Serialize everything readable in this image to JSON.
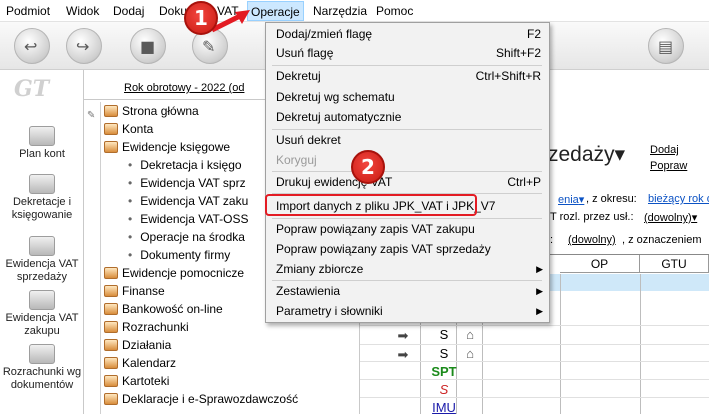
{
  "menubar": {
    "items": [
      "Podmiot",
      "Widok",
      "Dodaj",
      "Dokument VAT",
      "Operacje",
      "Narzędzia",
      "Pomoc"
    ]
  },
  "toolbar": {
    "icons": [
      "back-icon",
      "forward-icon",
      "stamp-icon",
      "pen-icon",
      "document-icon"
    ]
  },
  "sidebar": {
    "logo": "GT",
    "items": [
      {
        "label": "Plan kont"
      },
      {
        "label": "Dekretacje i księgowanie"
      },
      {
        "label": "Ewidencja VAT sprzedaży"
      },
      {
        "label": "Ewidencja VAT zakupu"
      },
      {
        "label": "Rozrachunki wg dokumentów"
      }
    ]
  },
  "year_label": "Rok obrotowy - 2022  (od",
  "tree": {
    "items": [
      {
        "label": "Strona główna",
        "level": 0
      },
      {
        "label": "Konta",
        "level": 0
      },
      {
        "label": "Ewidencje księgowe",
        "level": 0
      },
      {
        "label": "Dekretacja i księgo",
        "level": 1
      },
      {
        "label": "Ewidencja VAT sprz",
        "level": 1
      },
      {
        "label": "Ewidencja VAT zaku",
        "level": 1
      },
      {
        "label": "Ewidencja VAT-OSS",
        "level": 1
      },
      {
        "label": "Operacje na środka",
        "level": 1
      },
      {
        "label": "Dokumenty firmy",
        "level": 1
      },
      {
        "label": "Ewidencje pomocnicze",
        "level": 0
      },
      {
        "label": "Finanse",
        "level": 0
      },
      {
        "label": "Bankowość on-line",
        "level": 0
      },
      {
        "label": "Rozrachunki",
        "level": 0
      },
      {
        "label": "Działania",
        "level": 0
      },
      {
        "label": "Kalendarz",
        "level": 0
      },
      {
        "label": "Kartoteki",
        "level": 0
      },
      {
        "label": "Deklaracje i e-Sprawozdawczość",
        "level": 0
      }
    ]
  },
  "main": {
    "title": "zedaży",
    "add_link": "Dodaj",
    "correct_link": "Popraw",
    "filter1_value": "enia",
    "filter1_period_label": ", z okresu:",
    "filter1_period_value": "bieżący rok o",
    "filter2_label": "T rozl. przez usł.:",
    "filter2_value": "(dowolny)",
    "filter3_label": ":",
    "filter3_value": "(dowolny)",
    "filter3_suffix": ", z oznaczeniem"
  },
  "grid": {
    "headers": [
      "OP",
      "GTU"
    ],
    "rows": [
      {
        "arrow": "➡",
        "code": "S",
        "icon": "house-icon"
      },
      {
        "arrow": "➡",
        "code": "S",
        "icon": "house-icon"
      },
      {
        "arrow": "",
        "code": "SPT",
        "icon": ""
      },
      {
        "arrow": "",
        "code": "S",
        "icon": ""
      },
      {
        "arrow": "",
        "code": "IMU",
        "icon": ""
      }
    ],
    "colors": {
      "spt": "#1a8a1a",
      "s_red": "#cc2222",
      "imu": "#1a1aaa"
    }
  },
  "dropdown": {
    "items": [
      {
        "label": "Dodaj/zmień flagę",
        "shortcut": "F2",
        "enabled": true
      },
      {
        "label": "Usuń flagę",
        "shortcut": "Shift+F2",
        "enabled": true
      },
      {
        "label": "Dekretuj",
        "shortcut": "Ctrl+Shift+R",
        "enabled": true
      },
      {
        "label": "Dekretuj wg schematu",
        "shortcut": "",
        "enabled": true
      },
      {
        "label": "Dekretuj automatycznie",
        "shortcut": "",
        "enabled": true
      },
      {
        "label": "Usuń dekret",
        "shortcut": "",
        "enabled": true
      },
      {
        "label": "Koryguj",
        "shortcut": "",
        "enabled": false
      },
      {
        "label": "Drukuj ewidencję VAT",
        "shortcut": "Ctrl+P",
        "enabled": true
      },
      {
        "label": "Import danych z pliku JPK_VAT i JPK_V7",
        "shortcut": "",
        "enabled": true
      },
      {
        "label": "Popraw powiązany zapis VAT zakupu",
        "shortcut": "",
        "enabled": true
      },
      {
        "label": "Popraw powiązany zapis VAT sprzedaży",
        "shortcut": "",
        "enabled": true
      },
      {
        "label": "Zmiany zbiorcze",
        "shortcut": "",
        "enabled": true,
        "submenu": true
      },
      {
        "label": "Zestawienia",
        "shortcut": "",
        "enabled": true,
        "submenu": true
      },
      {
        "label": "Parametry i słowniki",
        "shortcut": "",
        "enabled": true,
        "submenu": true
      }
    ]
  },
  "annotations": {
    "badge1": "1",
    "badge2": "2",
    "color": "#e31b23"
  }
}
